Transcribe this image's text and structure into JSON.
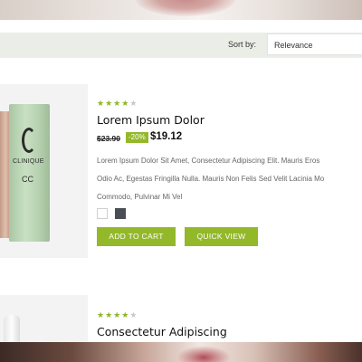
{
  "toolbar": {
    "sort_label": "Sort by:",
    "sort_value": "Relevance"
  },
  "products": [
    {
      "rating": 4,
      "rating_max": 5,
      "title": "Lorem Ipsum Dolor",
      "old_price": "$23.90",
      "discount": "-20%",
      "price": "$19.12",
      "description_lines": [
        "Lorem Ipsum Dolor Sit Amet, Consectetur Adipiscing Elit. Mauris Eros",
        "Odio Ac, Egestas Fringilla Nulla. Mauris Non Felis Sed Velit Lacinia Mo",
        "Commodo, Pulvinar Mi Vel"
      ],
      "image_label": {
        "brand": "CLINIQUE",
        "product": "CC"
      },
      "swatches": [
        "#ffffff",
        "#4a4d54"
      ],
      "add_to_cart_label": "ADD TO CART",
      "quick_view_label": "QUICK VIEW"
    },
    {
      "rating": 4,
      "rating_max": 5,
      "title": "Consectetur Adipiscing"
    }
  ],
  "colors": {
    "accent": "#93b82a",
    "star_on": "#8fb52b",
    "star_off": "#c8c8c8",
    "toolbar_bg": "#eaeee6"
  }
}
